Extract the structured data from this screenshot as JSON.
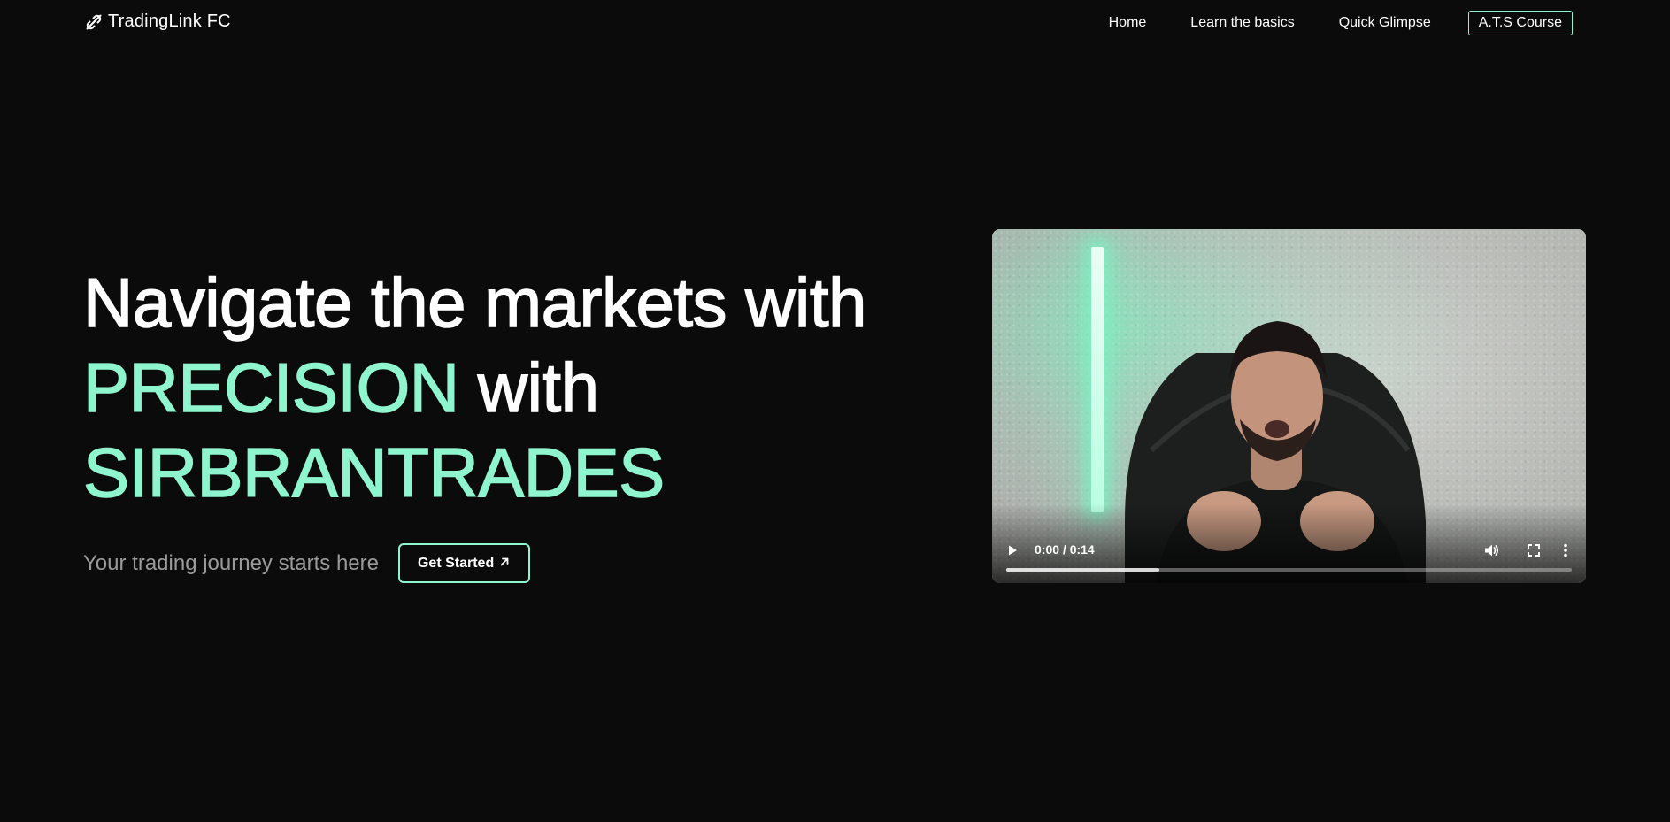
{
  "nav": {
    "brand": "TradingLink FC",
    "brand_icon": "link-icon",
    "links": [
      "Home",
      "Learn the basics",
      "Quick Glimpse"
    ],
    "cta": "A.T.S Course"
  },
  "hero": {
    "line1": "Navigate the markets with",
    "line2_accent": "PRECISION",
    "line2_rest": " with",
    "line3_accent": "SIRBRANTRADES",
    "tagline": "Your trading journey starts here",
    "button_label": "Get Started",
    "button_icon": "arrow-up-right-icon"
  },
  "video": {
    "time_display": "0:00 / 0:14",
    "buffered_fraction": 0.27,
    "controls": [
      "play-icon",
      "volume-icon",
      "fullscreen-icon",
      "more-vertical-icon"
    ]
  },
  "colors": {
    "background": "#0b0b0b",
    "accent": "#8ef5cf",
    "text": "#ffffff",
    "muted": "#9a9a9a"
  }
}
